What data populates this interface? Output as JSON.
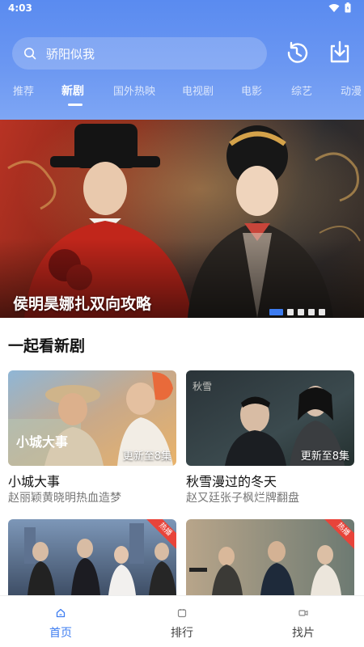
{
  "status_bar": {
    "time": "4:03"
  },
  "search": {
    "placeholder": "骄阳似我"
  },
  "tabs": [
    {
      "label": "推荐"
    },
    {
      "label": "新剧"
    },
    {
      "label": "国外热映"
    },
    {
      "label": "电视剧"
    },
    {
      "label": "电影"
    },
    {
      "label": "综艺"
    },
    {
      "label": "动漫"
    }
  ],
  "active_tab": "新剧",
  "banner": {
    "title": "侯明昊娜扎双向攻略",
    "page_count": 5,
    "current_page": 1
  },
  "section": {
    "title": "一起看新剧"
  },
  "cards": [
    {
      "name": "小城大事",
      "desc": "赵丽颖黄晓明热血造梦",
      "update": "更新至8集"
    },
    {
      "name": "秋雪漫过的冬天",
      "desc": "赵又廷张子枫烂牌翻盘",
      "update": "更新至8集"
    },
    {
      "name": "",
      "desc": "",
      "update": ""
    },
    {
      "name": "",
      "desc": "",
      "update": ""
    }
  ],
  "bottom_nav": [
    {
      "label": "首页",
      "icon": "home-icon"
    },
    {
      "label": "排行",
      "icon": "trophy-icon"
    },
    {
      "label": "找片",
      "icon": "video-icon"
    }
  ],
  "colors": {
    "accent": "#3d7cf0",
    "header_top": "#5a8bf0",
    "hot_badge": "#e8443a"
  }
}
